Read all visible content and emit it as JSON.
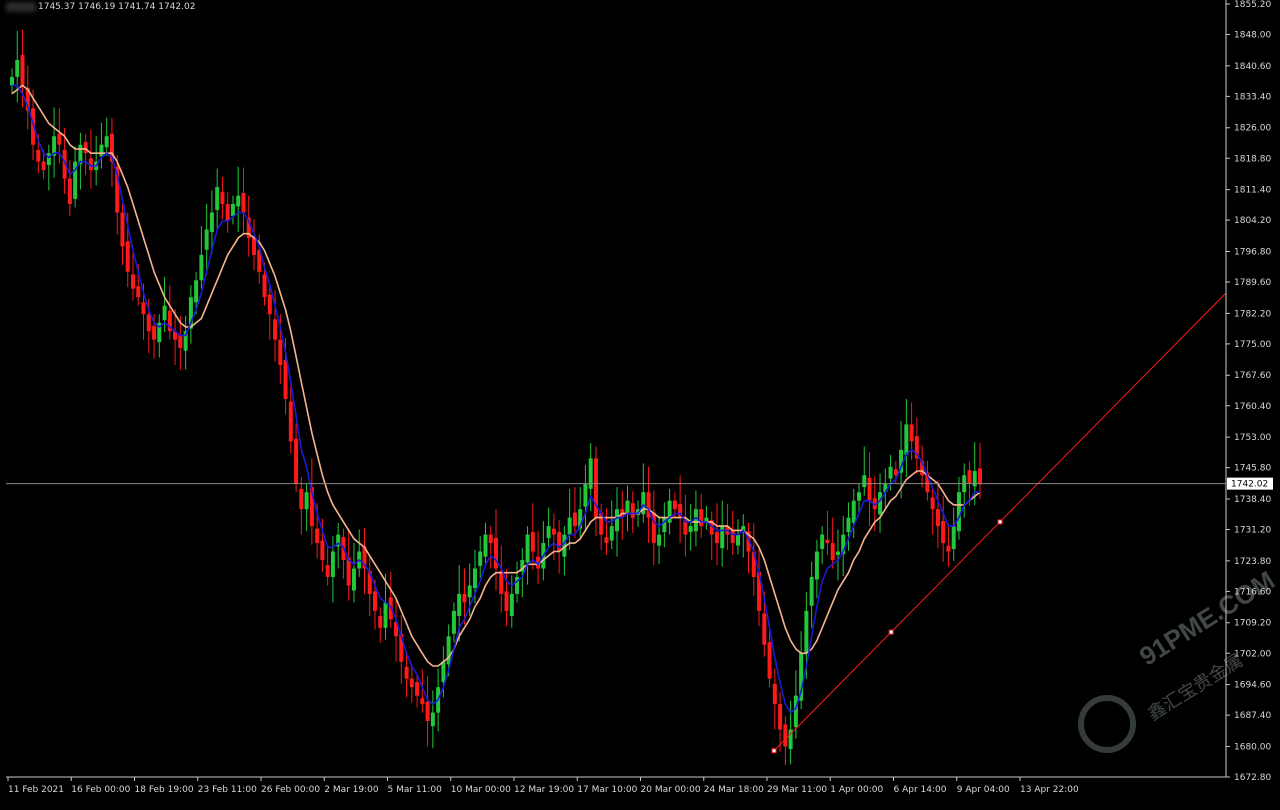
{
  "header": {
    "ohlc": "1745.37 1746.19 1741.74 1742.02"
  },
  "colors": {
    "background": "#000000",
    "bull": "#22c83a",
    "bear": "#ff1a1a",
    "ma_fast": "#1b1bd8",
    "ma_slow": "#f7b58e",
    "trendline": "#ff1a1a",
    "axis": "#c8c8c8",
    "price_line": "#8a8a8a"
  },
  "chart_data": {
    "type": "candlestick",
    "y_ticks": [
      "1855.20",
      "1848.00",
      "1840.60",
      "1833.40",
      "1826.00",
      "1818.80",
      "1811.40",
      "1804.20",
      "1796.80",
      "1789.60",
      "1782.20",
      "1775.00",
      "1767.60",
      "1760.40",
      "1753.00",
      "1745.80",
      "1738.40",
      "1731.20",
      "1723.80",
      "1716.60",
      "1709.20",
      "1702.00",
      "1694.60",
      "1687.40",
      "1680.00",
      "1672.80"
    ],
    "ylim": [
      1672.8,
      1855.2
    ],
    "x_labels": [
      "11 Feb 2021",
      "16 Feb 00:00",
      "18 Feb 19:00",
      "23 Feb 11:00",
      "26 Feb 00:00",
      "2 Mar 19:00",
      "5 Mar 11:00",
      "10 Mar 00:00",
      "12 Mar 19:00",
      "17 Mar 10:00",
      "20 Mar 00:00",
      "24 Mar 18:00",
      "29 Mar 11:00",
      "1 Apr 00:00",
      "6 Apr 14:00",
      "9 Apr 04:00",
      "13 Apr 22:00"
    ],
    "current_price": 1742.02,
    "current_price_label": "1742.02",
    "series": [
      {
        "type": "candles",
        "close": [
          1838,
          1842,
          1836,
          1830,
          1822,
          1818,
          1816,
          1820,
          1824,
          1822,
          1814,
          1808,
          1818,
          1822,
          1820,
          1816,
          1818,
          1822,
          1824,
          1818,
          1806,
          1798,
          1792,
          1788,
          1786,
          1782,
          1778,
          1776,
          1780,
          1784,
          1778,
          1776,
          1774,
          1778,
          1786,
          1790,
          1796,
          1802,
          1806,
          1812,
          1808,
          1804,
          1808,
          1810,
          1806,
          1800,
          1796,
          1792,
          1786,
          1782,
          1776,
          1770,
          1762,
          1752,
          1742,
          1736,
          1740,
          1732,
          1728,
          1724,
          1720,
          1726,
          1730,
          1724,
          1718,
          1722,
          1726,
          1722,
          1716,
          1712,
          1708,
          1714,
          1710,
          1706,
          1700,
          1696,
          1694,
          1692,
          1690,
          1686,
          1688,
          1694,
          1700,
          1706,
          1712,
          1716,
          1714,
          1718,
          1722,
          1726,
          1730,
          1728,
          1722,
          1716,
          1712,
          1716,
          1720,
          1724,
          1730,
          1726,
          1722,
          1728,
          1732,
          1730,
          1726,
          1730,
          1734,
          1732,
          1736,
          1742,
          1748,
          1734,
          1730,
          1728,
          1732,
          1736,
          1734,
          1738,
          1734,
          1736,
          1740,
          1734,
          1728,
          1730,
          1734,
          1738,
          1736,
          1734,
          1730,
          1732,
          1736,
          1732,
          1734,
          1730,
          1728,
          1732,
          1730,
          1728,
          1730,
          1732,
          1726,
          1720,
          1712,
          1704,
          1696,
          1690,
          1684,
          1680,
          1684,
          1692,
          1702,
          1712,
          1720,
          1726,
          1730,
          1728,
          1724,
          1726,
          1730,
          1734,
          1738,
          1740,
          1744,
          1738,
          1736,
          1740,
          1742,
          1746,
          1744,
          1750,
          1756,
          1752,
          1748,
          1744,
          1740,
          1736,
          1732,
          1728,
          1726,
          1732,
          1740,
          1744,
          1742,
          1745,
          1742
        ]
      }
    ],
    "ma_fast": [
      1836,
      1836,
      1834,
      1831,
      1827,
      1823,
      1820,
      1819,
      1820,
      1820,
      1818,
      1815,
      1816,
      1818,
      1818,
      1817,
      1817,
      1819,
      1820,
      1819,
      1815,
      1809,
      1803,
      1797,
      1792,
      1787,
      1783,
      1780,
      1779,
      1780,
      1779,
      1778,
      1777,
      1777,
      1780,
      1783,
      1787,
      1792,
      1797,
      1802,
      1804,
      1804,
      1805,
      1806,
      1806,
      1804,
      1801,
      1798,
      1793,
      1789,
      1784,
      1779,
      1773,
      1766,
      1758,
      1750,
      1746,
      1740,
      1735,
      1731,
      1727,
      1727,
      1728,
      1727,
      1724,
      1723,
      1724,
      1723,
      1721,
      1718,
      1715,
      1714,
      1713,
      1710,
      1706,
      1702,
      1699,
      1697,
      1694,
      1691,
      1690,
      1691,
      1694,
      1698,
      1703,
      1708,
      1710,
      1713,
      1716,
      1719,
      1723,
      1725,
      1724,
      1722,
      1719,
      1718,
      1719,
      1720,
      1723,
      1724,
      1723,
      1725,
      1727,
      1728,
      1727,
      1728,
      1730,
      1730,
      1732,
      1735,
      1739,
      1737,
      1735,
      1733,
      1733,
      1734,
      1734,
      1735,
      1735,
      1735,
      1737,
      1736,
      1733,
      1732,
      1733,
      1734,
      1735,
      1735,
      1733,
      1733,
      1734,
      1733,
      1733,
      1732,
      1731,
      1731,
      1731,
      1730,
      1730,
      1731,
      1729,
      1726,
      1721,
      1715,
      1708,
      1701,
      1695,
      1690,
      1688,
      1689,
      1693,
      1699,
      1706,
      1713,
      1719,
      1722,
      1723,
      1724,
      1726,
      1729,
      1732,
      1735,
      1738,
      1738,
      1737,
      1738,
      1740,
      1742,
      1743,
      1746,
      1749,
      1750,
      1749,
      1747,
      1744,
      1741,
      1738,
      1735,
      1732,
      1732,
      1734,
      1737,
      1738,
      1740,
      1740
    ],
    "ma_slow": [
      1834,
      1835,
      1836,
      1835,
      1833,
      1831,
      1829,
      1827,
      1826,
      1825,
      1824,
      1822,
      1821,
      1821,
      1821,
      1820,
      1820,
      1820,
      1820,
      1820,
      1818,
      1815,
      1812,
      1808,
      1804,
      1800,
      1796,
      1792,
      1789,
      1786,
      1784,
      1782,
      1780,
      1779,
      1779,
      1780,
      1781,
      1784,
      1787,
      1790,
      1793,
      1796,
      1798,
      1800,
      1801,
      1801,
      1800,
      1799,
      1797,
      1794,
      1791,
      1787,
      1783,
      1778,
      1772,
      1766,
      1760,
      1754,
      1749,
      1744,
      1740,
      1737,
      1735,
      1733,
      1731,
      1729,
      1728,
      1727,
      1725,
      1723,
      1721,
      1719,
      1717,
      1715,
      1712,
      1709,
      1706,
      1704,
      1702,
      1700,
      1699,
      1699,
      1700,
      1701,
      1703,
      1706,
      1708,
      1710,
      1713,
      1715,
      1718,
      1720,
      1721,
      1721,
      1721,
      1721,
      1721,
      1722,
      1723,
      1723,
      1723,
      1724,
      1725,
      1726,
      1726,
      1727,
      1728,
      1728,
      1729,
      1731,
      1733,
      1734,
      1734,
      1734,
      1734,
      1734,
      1735,
      1735,
      1735,
      1735,
      1736,
      1736,
      1735,
      1734,
      1734,
      1734,
      1734,
      1734,
      1734,
      1733,
      1733,
      1733,
      1733,
      1733,
      1732,
      1732,
      1732,
      1731,
      1731,
      1731,
      1730,
      1729,
      1727,
      1724,
      1720,
      1716,
      1712,
      1708,
      1705,
      1703,
      1702,
      1702,
      1703,
      1705,
      1708,
      1711,
      1714,
      1717,
      1719,
      1721,
      1724,
      1726,
      1729,
      1731,
      1733,
      1734,
      1736,
      1738,
      1739,
      1741,
      1743,
      1744,
      1745,
      1745,
      1744,
      1743,
      1742,
      1740,
      1738,
      1737,
      1737,
      1737,
      1738,
      1739,
      1740
    ],
    "trendline": {
      "from_price": 1679,
      "to_price": 1787,
      "anchors": [
        1679,
        1707,
        1733
      ]
    }
  }
}
